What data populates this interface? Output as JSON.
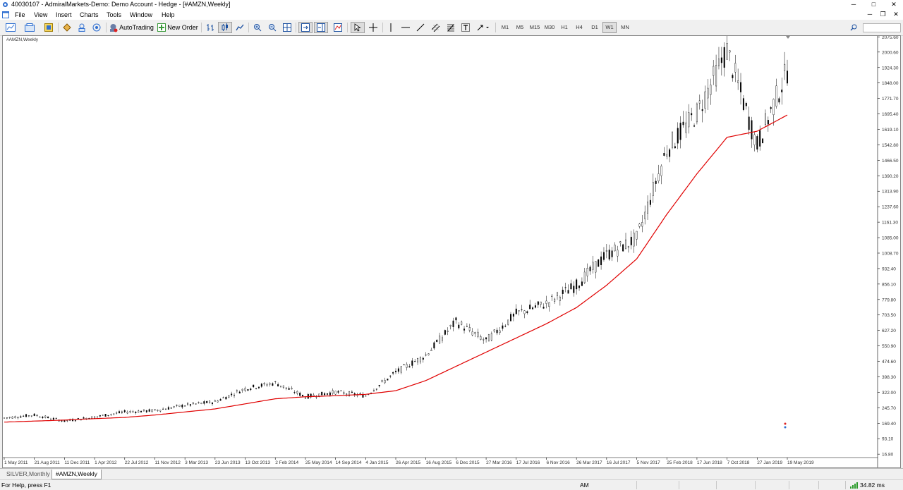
{
  "window": {
    "title": "40030107 - AdmiralMarkets-Demo: Demo Account - Hedge - [#AMZN,Weekly]",
    "minimize": "─",
    "maximize": "□",
    "close": "✕"
  },
  "menu": {
    "items": [
      "File",
      "View",
      "Insert",
      "Charts",
      "Tools",
      "Window",
      "Help"
    ],
    "mdi_minimize": "─",
    "mdi_restore": "❐",
    "mdi_close": "✕"
  },
  "toolbar": {
    "autotrading_label": "AutoTrading",
    "new_order_label": "New Order",
    "periods": [
      "M1",
      "M5",
      "M15",
      "M30",
      "H1",
      "H4",
      "D1",
      "W1",
      "MN"
    ],
    "active_period": "W1"
  },
  "chart": {
    "label": "#AMZN,Weekly"
  },
  "chart_data": {
    "type": "candlestick",
    "symbol": "#AMZN",
    "timeframe": "Weekly",
    "ylim": [
      0,
      2073
    ],
    "y_ticks": [
      "2075.60",
      "2000.60",
      "1924.30",
      "1848.00",
      "1771.70",
      "1695.40",
      "1619.10",
      "1542.80",
      "1466.50",
      "1390.20",
      "1313.90",
      "1237.60",
      "1161.30",
      "1085.00",
      "1008.70",
      "932.40",
      "856.10",
      "779.80",
      "703.50",
      "627.20",
      "550.90",
      "474.60",
      "398.30",
      "322.00",
      "245.70",
      "169.40",
      "93.10",
      "16.80"
    ],
    "x_ticks": [
      "1 May 2011",
      "21 Aug 2011",
      "11 Dec 2011",
      "1 Apr 2012",
      "22 Jul 2012",
      "11 Nov 2012",
      "3 Mar 2013",
      "23 Jun 2013",
      "13 Oct 2013",
      "2 Feb 2014",
      "25 May 2014",
      "14 Sep 2014",
      "4 Jan 2015",
      "26 Apr 2015",
      "16 Aug 2015",
      "6 Dec 2015",
      "27 Mar 2016",
      "17 Jul 2016",
      "6 Nov 2016",
      "26 Mar 2017",
      "16 Jul 2017",
      "5 Nov 2017",
      "25 Feb 2018",
      "17 Jun 2018",
      "7 Oct 2018",
      "27 Jan 2019",
      "19 May 2019"
    ],
    "price_path": [
      [
        "1 May 2011",
        195
      ],
      [
        "21 Aug 2011",
        210
      ],
      [
        "11 Dec 2011",
        180
      ],
      [
        "1 Apr 2012",
        200
      ],
      [
        "22 Jul 2012",
        225
      ],
      [
        "11 Nov 2012",
        232
      ],
      [
        "3 Mar 2013",
        258
      ],
      [
        "23 Jun 2013",
        275
      ],
      [
        "13 Oct 2013",
        340
      ],
      [
        "2 Feb 2014",
        368
      ],
      [
        "25 May 2014",
        300
      ],
      [
        "14 Sep 2014",
        323
      ],
      [
        "4 Jan 2015",
        305
      ],
      [
        "26 Apr 2015",
        420
      ],
      [
        "16 Aug 2015",
        505
      ],
      [
        "6 Dec 2015",
        670
      ],
      [
        "27 Mar 2016",
        575
      ],
      [
        "17 Jul 2016",
        710
      ],
      [
        "6 Nov 2016",
        760
      ],
      [
        "26 Mar 2017",
        850
      ],
      [
        "16 Jul 2017",
        1000
      ],
      [
        "5 Nov 2017",
        1080
      ],
      [
        "25 Feb 2018",
        1520
      ],
      [
        "17 Jun 2018",
        1700
      ],
      [
        "7 Oct 2018",
        2010
      ],
      [
        "27 Jan 2019",
        1540
      ],
      [
        "19 May 2019",
        1910
      ]
    ],
    "moving_average": {
      "color": "#e00000",
      "values": [
        175,
        180,
        185,
        192,
        198,
        210,
        225,
        240,
        265,
        290,
        300,
        305,
        312,
        330,
        380,
        450,
        520,
        590,
        660,
        740,
        850,
        980,
        1200,
        1400,
        1580,
        1610,
        1690
      ]
    },
    "colors": {
      "bull": "#008000",
      "bear": "#cc0000",
      "background": "#ffffff"
    },
    "grid": false
  },
  "tabs": [
    {
      "label": "SILVER,Monthly",
      "active": false
    },
    {
      "label": "#AMZN,Weekly",
      "active": true
    }
  ],
  "status": {
    "help_text": "For Help, press F1",
    "session": "AM",
    "ping": "34.82 ms"
  }
}
